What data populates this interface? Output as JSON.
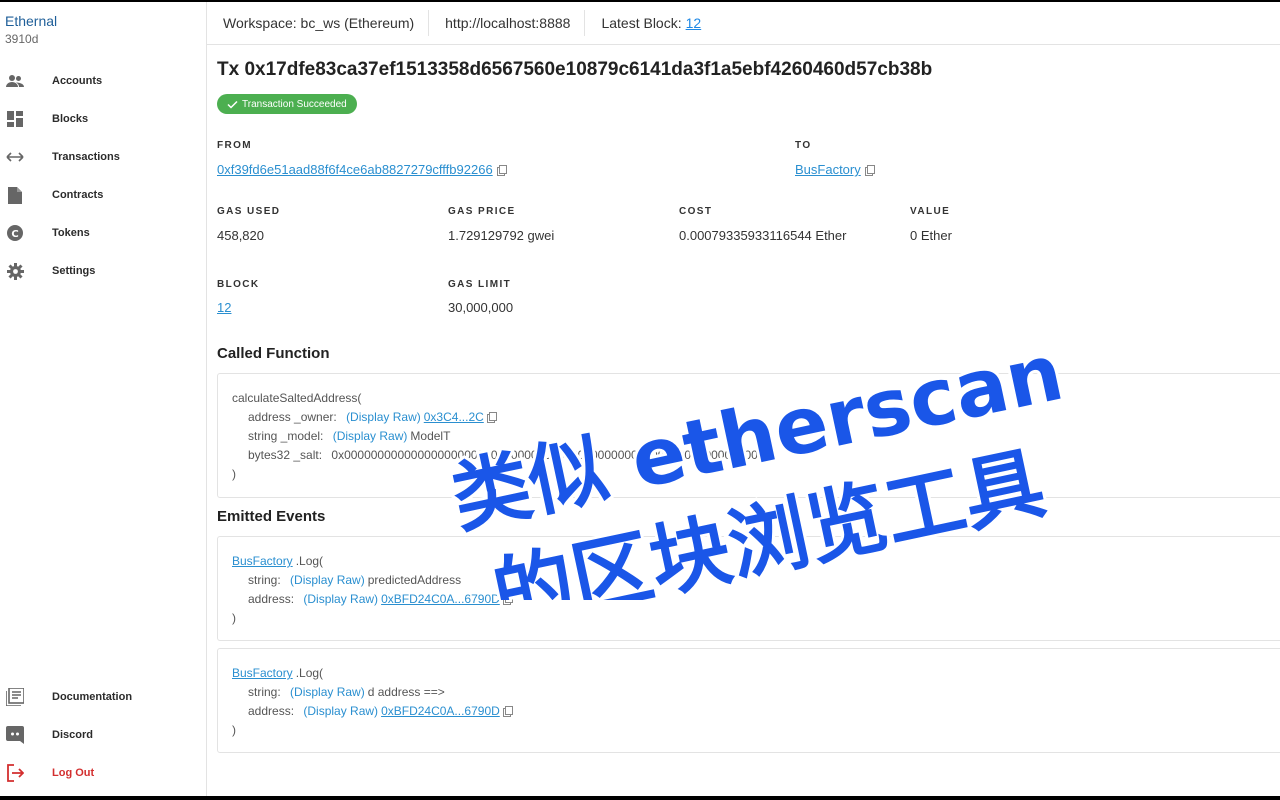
{
  "app": {
    "name": "Ethernal",
    "sub": "3910d"
  },
  "sidebar": {
    "items": [
      {
        "label": "Accounts",
        "icon": "accounts-icon"
      },
      {
        "label": "Blocks",
        "icon": "blocks-icon"
      },
      {
        "label": "Transactions",
        "icon": "transactions-icon"
      },
      {
        "label": "Contracts",
        "icon": "contracts-icon"
      },
      {
        "label": "Tokens",
        "icon": "tokens-icon"
      },
      {
        "label": "Settings",
        "icon": "settings-icon"
      }
    ],
    "bottom": [
      {
        "label": "Documentation",
        "icon": "documentation-icon"
      },
      {
        "label": "Discord",
        "icon": "discord-icon"
      },
      {
        "label": "Log Out",
        "icon": "logout-icon"
      }
    ]
  },
  "header": {
    "workspace": "Workspace: bc_ws (Ethereum)",
    "rpc": "http://localhost:8888",
    "latest_block_label": "Latest Block:",
    "latest_block": "12"
  },
  "tx": {
    "title": "Tx 0x17dfe83ca37ef1513358d6567560e10879c6141da3f1a5ebf4260460d57cb38b",
    "status": "Transaction Succeeded",
    "from_label": "FROM",
    "from": "0xf39fd6e51aad88f6f4ce6ab8827279cfffb92266",
    "to_label": "TO",
    "to": "BusFactory",
    "gas_used_label": "GAS USED",
    "gas_used": "458,820",
    "gas_price_label": "GAS PRICE",
    "gas_price": "1.729129792 gwei",
    "cost_label": "COST",
    "cost": "0.00079335933116544 Ether",
    "value_label": "VALUE",
    "value": "0 Ether",
    "block_label": "BLOCK",
    "block": "12",
    "gas_limit_label": "GAS LIMIT",
    "gas_limit": "30,000,000"
  },
  "called_function": {
    "title": "Called Function",
    "name": "calculateSaltedAddress(",
    "params": [
      {
        "label": "address _owner:",
        "display_raw": "(Display Raw)",
        "value": "0x3C4...2C",
        "is_link": true
      },
      {
        "label": "string _model:",
        "display_raw": "(Display Raw)",
        "value": "ModelT",
        "is_link": false
      },
      {
        "label": "bytes32 _salt:",
        "display_raw": "",
        "value": "0x0000000000000000000000000000000000000000000000000000000000000000",
        "is_link": false
      }
    ],
    "close": ")"
  },
  "events": {
    "title": "Emitted Events",
    "items": [
      {
        "contract": "BusFactory",
        "call": ".Log(",
        "params": [
          {
            "label": "string:",
            "display_raw": "(Display Raw)",
            "value": "predictedAddress",
            "is_link": false
          },
          {
            "label": "address:",
            "display_raw": "(Display Raw)",
            "value": "0xBFD24C0A...6790D",
            "is_link": true
          }
        ],
        "close": ")"
      },
      {
        "contract": "BusFactory",
        "call": ".Log(",
        "params": [
          {
            "label": "string:",
            "display_raw": "(Display Raw)",
            "value": "d address ==>",
            "is_link": false
          },
          {
            "label": "address:",
            "display_raw": "(Display Raw)",
            "value": "0xBFD24C0A...6790D",
            "is_link": true
          }
        ],
        "close": ")"
      }
    ]
  },
  "overlay": {
    "line1": "类似 etherscan",
    "line2": "的区块浏览工具",
    "color": "#1a56e8"
  }
}
